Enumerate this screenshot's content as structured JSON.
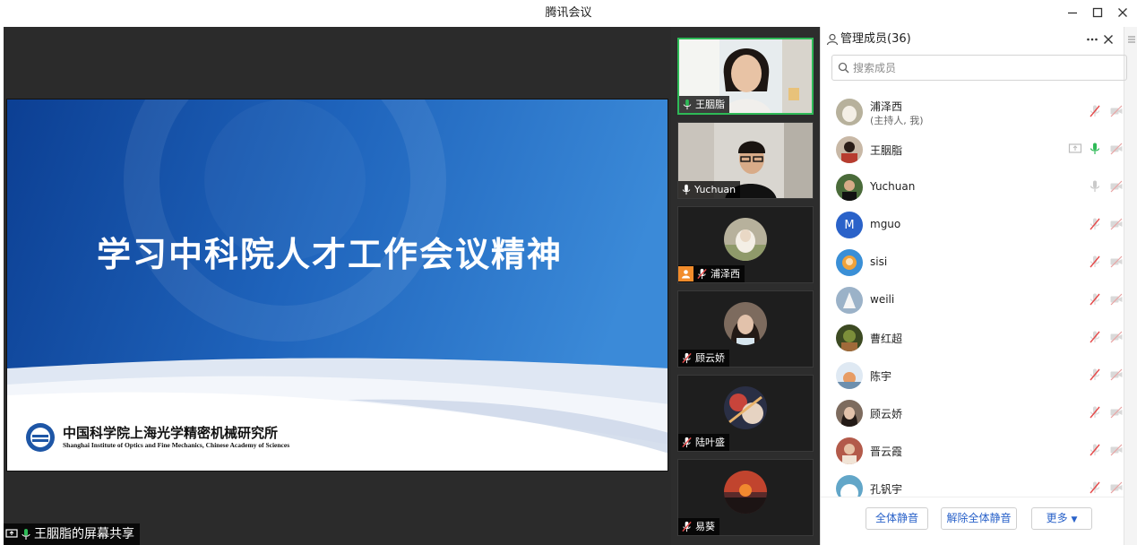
{
  "window": {
    "title": "腾讯会议"
  },
  "slide": {
    "title": "学习中科院人才工作会议精神",
    "institute_cn": "中国科学院上海光学精密机械研究所",
    "institute_en": "Shanghai Institute of Optics and Fine Mechanics, Chinese Academy of Sciences"
  },
  "share_label": "王胭脂的屏幕共享",
  "thumbnails": [
    {
      "name": "王胭脂"
    },
    {
      "name": "Yuchuan"
    },
    {
      "name": "浦泽西"
    },
    {
      "name": "顾云娇"
    },
    {
      "name": "陆叶盛"
    },
    {
      "name": "易葵"
    }
  ],
  "panel": {
    "title": "管理成员(36)",
    "search_placeholder": "搜索成员",
    "members": [
      {
        "name": "浦泽西",
        "sub": "(主持人, 我)",
        "mic": "muted",
        "cam": "off"
      },
      {
        "name": "王胭脂",
        "mic": "on",
        "cam": "off",
        "sharing": true
      },
      {
        "name": "Yuchuan",
        "mic": "idle",
        "cam": "off"
      },
      {
        "name": "mguo",
        "avatar_letter": "M",
        "mic": "muted",
        "cam": "off"
      },
      {
        "name": "sisi",
        "mic": "muted",
        "cam": "off"
      },
      {
        "name": "weili",
        "mic": "muted",
        "cam": "off"
      },
      {
        "name": "曹红超",
        "mic": "muted",
        "cam": "off"
      },
      {
        "name": "陈宇",
        "mic": "muted",
        "cam": "off"
      },
      {
        "name": "顾云娇",
        "mic": "muted",
        "cam": "off"
      },
      {
        "name": "晋云霞",
        "mic": "muted",
        "cam": "off"
      },
      {
        "name": "孔钒宇",
        "mic": "muted",
        "cam": "off"
      }
    ],
    "buttons": {
      "mute_all": "全体静音",
      "unmute_all": "解除全体静音",
      "more": "更多"
    }
  },
  "colors": {
    "accent_blue": "#2a62c9",
    "active_green": "#2eba57",
    "muted_red": "#e54a4a",
    "host_orange": "#f28c2b"
  }
}
